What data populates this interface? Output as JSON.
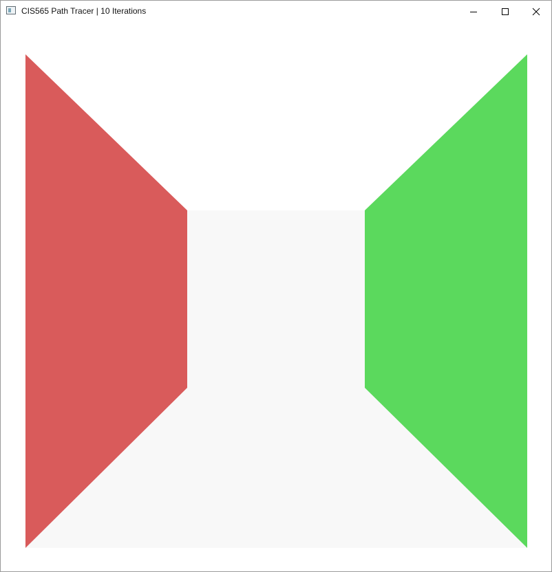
{
  "window": {
    "title": "CIS565 Path Tracer | 10 Iterations",
    "icon": "app-window-icon",
    "controls": {
      "minimize_icon": "minimize-icon",
      "maximize_icon": "maximize-icon",
      "close_icon": "close-icon"
    }
  },
  "scene": {
    "background_color": "#ffffff",
    "back_wall_color": "#f8f8f8",
    "floor_color": "#f8f8f8",
    "left_wall_color": "#d95b5b",
    "right_wall_color": "#5bd95d"
  }
}
